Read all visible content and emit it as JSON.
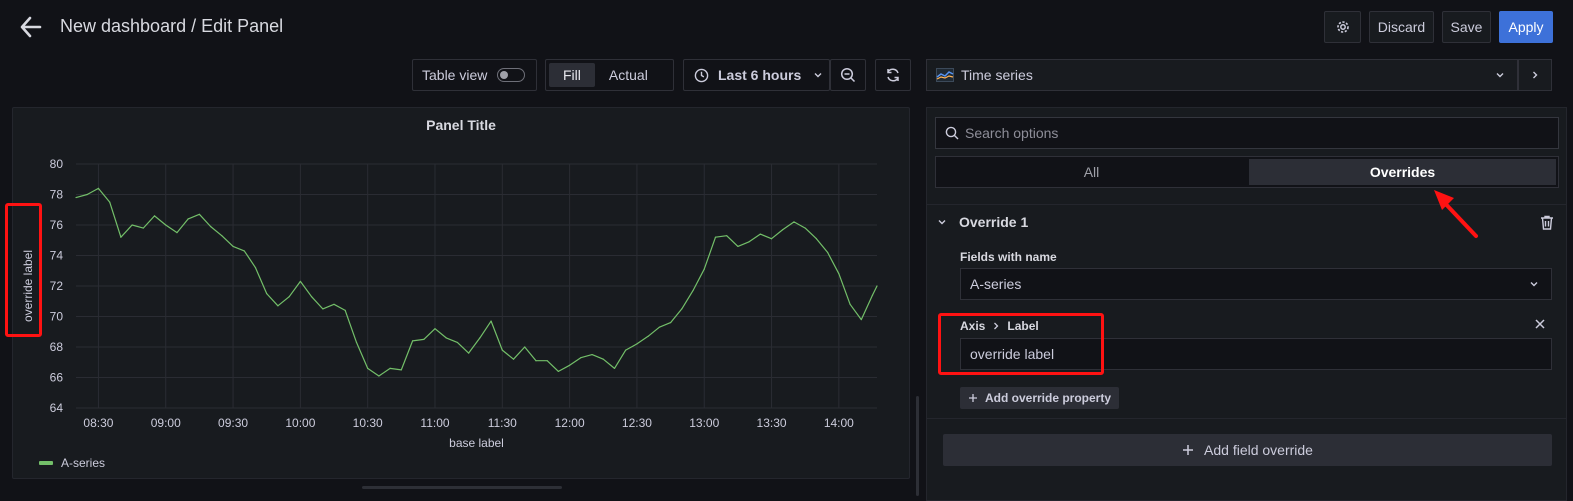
{
  "header": {
    "title": "New dashboard / Edit Panel",
    "discard_label": "Discard",
    "save_label": "Save",
    "apply_label": "Apply"
  },
  "toolbar": {
    "table_view_label": "Table view",
    "fill_label": "Fill",
    "actual_label": "Actual",
    "time_range": "Last 6 hours"
  },
  "panel": {
    "title": "Panel Title"
  },
  "chart_data": {
    "type": "line",
    "title": "Panel Title",
    "xlabel": "base label",
    "ylabel": "override label",
    "x_ticks": [
      "08:30",
      "09:00",
      "09:30",
      "10:00",
      "10:30",
      "11:00",
      "11:30",
      "12:00",
      "12:30",
      "13:00",
      "13:30",
      "14:00"
    ],
    "y_ticks": [
      64,
      66,
      68,
      70,
      72,
      74,
      76,
      78,
      80
    ],
    "ylim": [
      64,
      80
    ],
    "xlim": [
      "08:20",
      "14:17"
    ],
    "grid": true,
    "legend_position": "bottom-left",
    "series": [
      {
        "name": "A-series",
        "color": "#73bf69",
        "x": [
          "08:20",
          "08:25",
          "08:30",
          "08:35",
          "08:40",
          "08:45",
          "08:50",
          "08:55",
          "09:00",
          "09:05",
          "09:10",
          "09:15",
          "09:20",
          "09:25",
          "09:30",
          "09:35",
          "09:40",
          "09:45",
          "09:50",
          "09:55",
          "10:00",
          "10:05",
          "10:10",
          "10:15",
          "10:20",
          "10:25",
          "10:30",
          "10:35",
          "10:40",
          "10:45",
          "10:50",
          "10:55",
          "11:00",
          "11:05",
          "11:10",
          "11:15",
          "11:20",
          "11:25",
          "11:30",
          "11:35",
          "11:40",
          "11:45",
          "11:50",
          "11:55",
          "12:00",
          "12:05",
          "12:10",
          "12:15",
          "12:20",
          "12:25",
          "12:30",
          "12:35",
          "12:40",
          "12:45",
          "12:50",
          "12:55",
          "13:00",
          "13:05",
          "13:10",
          "13:15",
          "13:20",
          "13:25",
          "13:30",
          "13:35",
          "13:40",
          "13:45",
          "13:50",
          "13:55",
          "14:00",
          "14:05",
          "14:10",
          "14:15",
          "14:17"
        ],
        "values": [
          77.8,
          78.0,
          78.4,
          77.5,
          75.2,
          76.0,
          75.8,
          76.6,
          76.0,
          75.5,
          76.4,
          76.7,
          75.9,
          75.3,
          74.6,
          74.3,
          73.2,
          71.5,
          70.7,
          71.3,
          72.3,
          71.3,
          70.5,
          70.8,
          70.4,
          68.3,
          66.6,
          66.1,
          66.6,
          66.5,
          68.4,
          68.5,
          69.2,
          68.6,
          68.3,
          67.6,
          68.6,
          69.7,
          67.8,
          67.2,
          68.0,
          67.1,
          67.1,
          66.4,
          66.8,
          67.3,
          67.5,
          67.2,
          66.6,
          67.8,
          68.2,
          68.7,
          69.3,
          69.6,
          70.5,
          71.7,
          73.1,
          75.2,
          75.3,
          74.6,
          74.9,
          75.4,
          75.1,
          75.7,
          76.2,
          75.8,
          75.1,
          74.2,
          72.8,
          70.8,
          69.8,
          71.4,
          72.0
        ]
      }
    ]
  },
  "options": {
    "visualization": "Time series",
    "search_placeholder": "Search options",
    "tab_all": "All",
    "tab_overrides": "Overrides",
    "override_title": "Override 1",
    "matcher_label": "Fields with name",
    "matcher_value": "A-series",
    "property_category": "Axis",
    "property_name": "Label",
    "property_value": "override label",
    "add_property_label": "Add override property",
    "add_field_override_label": "Add field override"
  }
}
